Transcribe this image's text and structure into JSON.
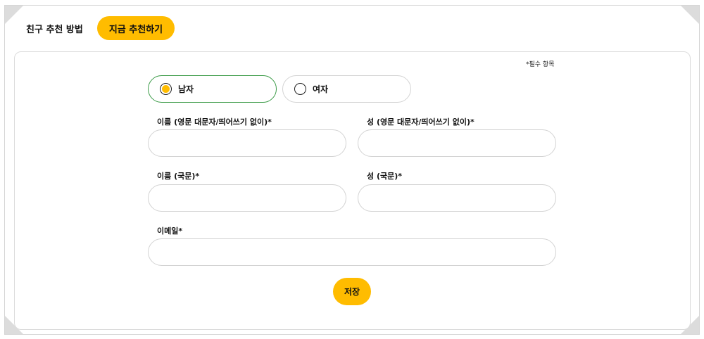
{
  "tabs": {
    "method_label": "친구 추천 방법",
    "recommend_now_label": "지금 추천하기"
  },
  "form": {
    "required_note": "*필수 항목",
    "gender": {
      "male_label": "남자",
      "female_label": "여자",
      "selected": "male"
    },
    "first_name_en": {
      "label": "이름 (영문 대문자/띄어쓰기 없이)*",
      "value": ""
    },
    "last_name_en": {
      "label": "성 (영문 대문자/띄어쓰기 없이)*",
      "value": ""
    },
    "first_name_kr": {
      "label": "이름 (국문)*",
      "value": ""
    },
    "last_name_kr": {
      "label": "성 (국문)*",
      "value": ""
    },
    "email": {
      "label": "이메일*",
      "value": ""
    },
    "save_label": "저장"
  },
  "colors": {
    "accent": "#ffbc00",
    "selected_border": "#3a9a46",
    "border": "#d3d3d3"
  }
}
